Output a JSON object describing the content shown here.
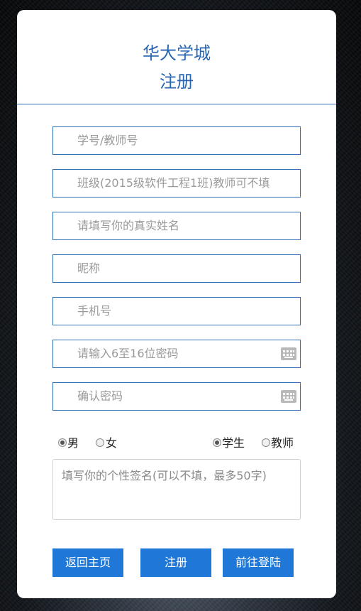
{
  "header": {
    "site_title": "华大学城",
    "page_title": "注册"
  },
  "fields": {
    "student_id": {
      "placeholder": "学号/教师号"
    },
    "class": {
      "placeholder": "班级(2015级软件工程1班)教师可不填"
    },
    "real_name": {
      "placeholder": "请填写你的真实姓名"
    },
    "nickname": {
      "placeholder": "昵称"
    },
    "phone": {
      "placeholder": "手机号"
    },
    "password": {
      "placeholder": "请输入6至16位密码",
      "icon": "keyboard-icon"
    },
    "confirm_password": {
      "placeholder": "确认密码",
      "icon": "keyboard-icon"
    }
  },
  "gender": {
    "options": [
      {
        "label": "男",
        "selected": true
      },
      {
        "label": "女",
        "selected": false
      }
    ]
  },
  "role": {
    "options": [
      {
        "label": "学生",
        "selected": true
      },
      {
        "label": "教师",
        "selected": false
      }
    ]
  },
  "signature": {
    "placeholder": "填写你的个性签名(可以不填，最多50字)"
  },
  "buttons": {
    "home": "返回主页",
    "register": "注册",
    "login": "前往登陆"
  },
  "colors": {
    "accent": "#1f78d8",
    "title": "#2a66b0",
    "border": "#2e6fb5"
  }
}
